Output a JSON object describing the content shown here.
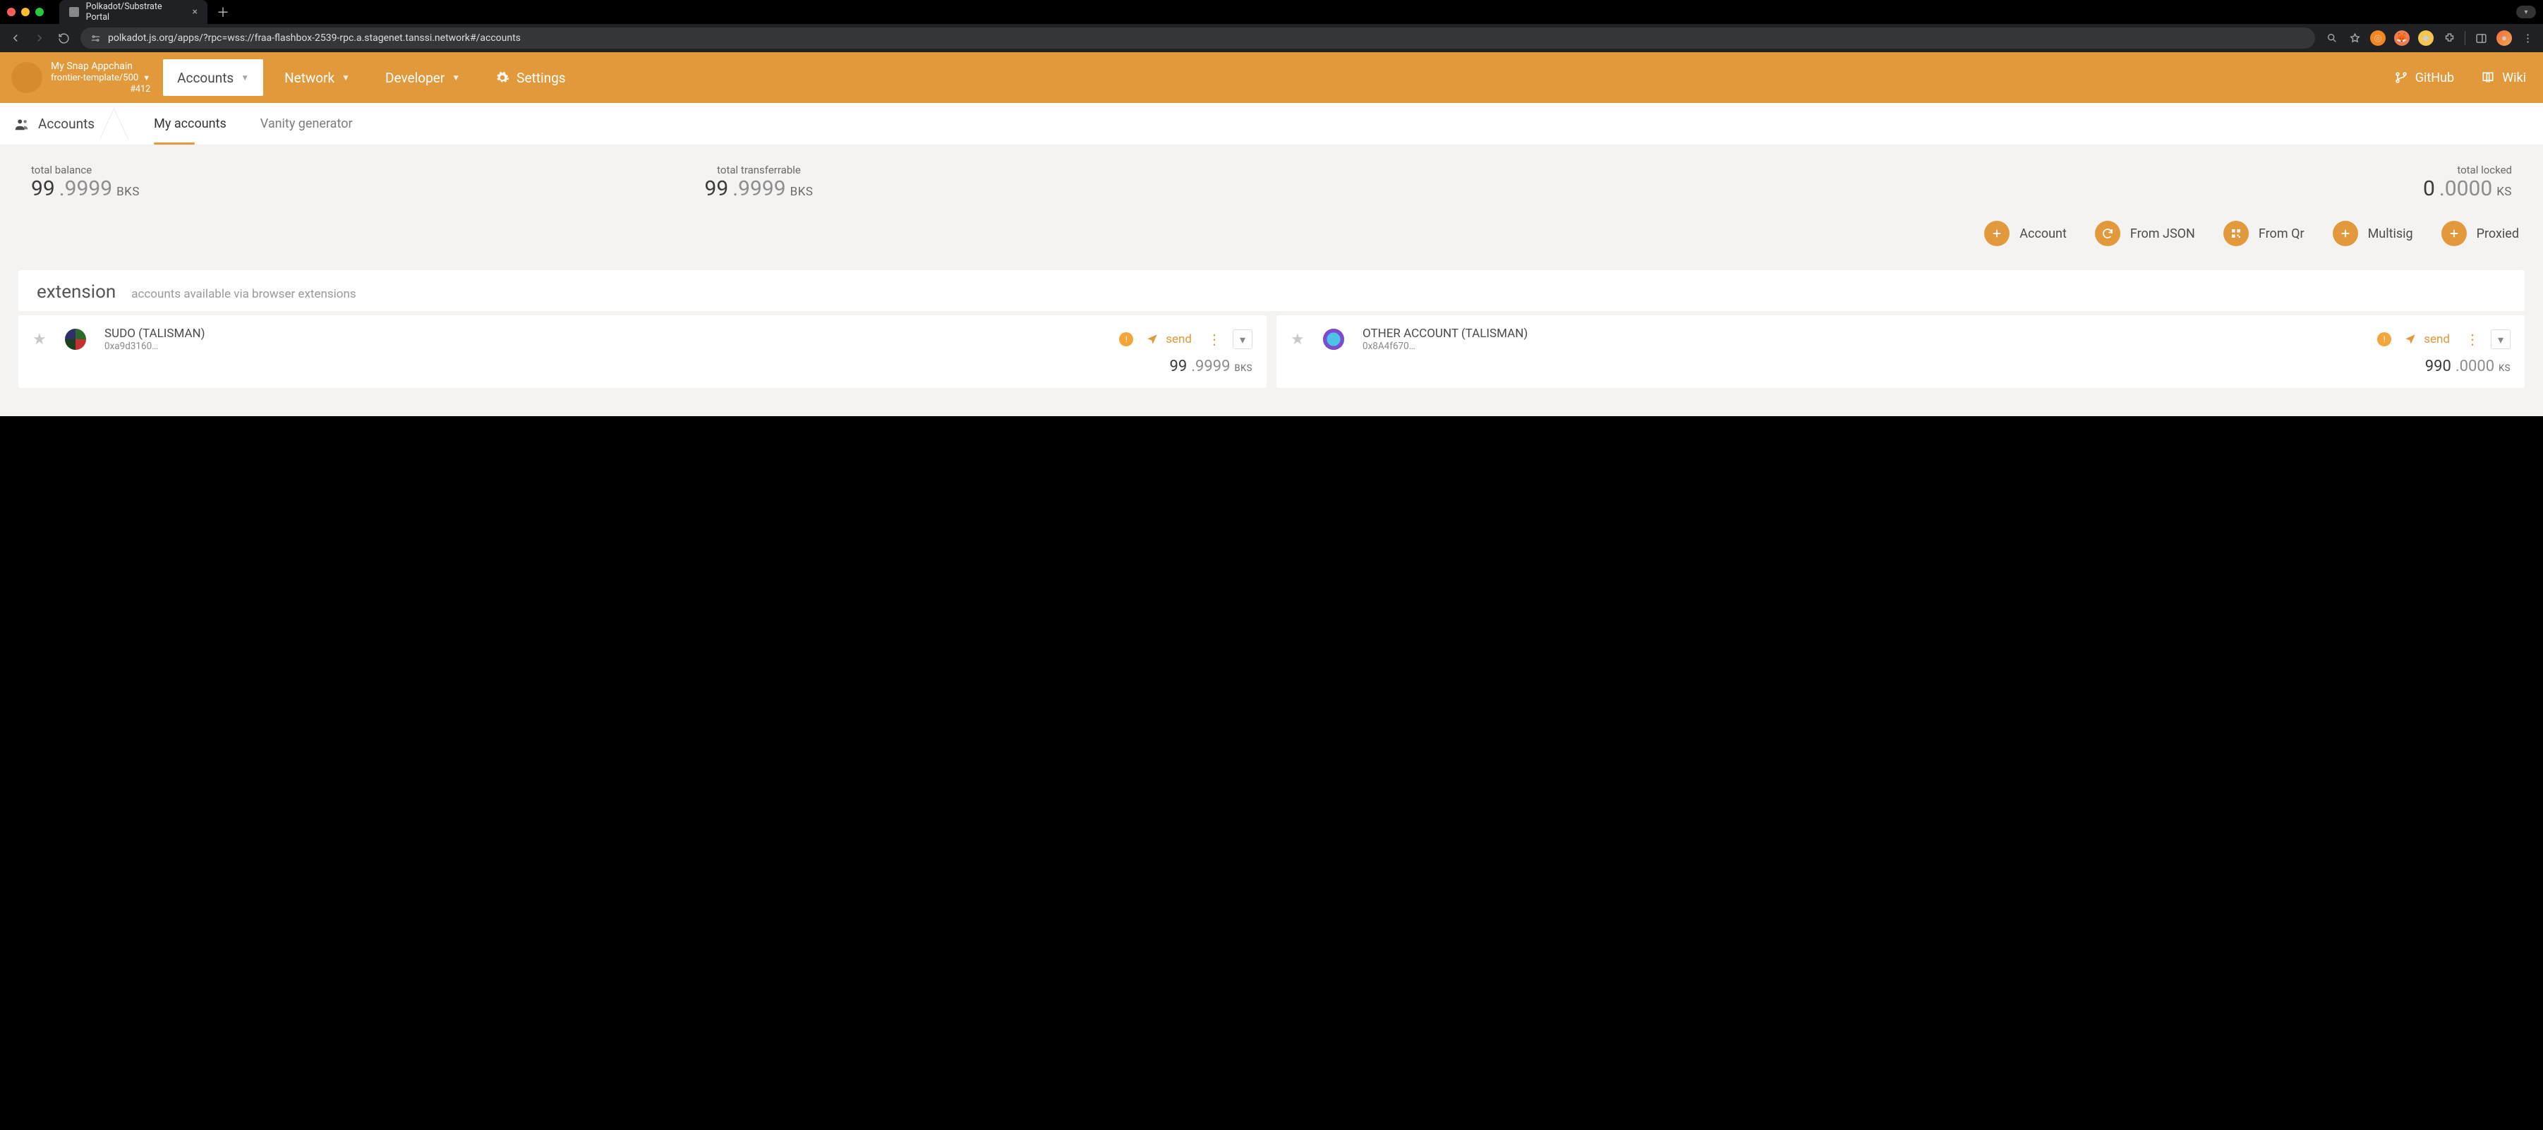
{
  "browser": {
    "tab_title": "Polkadot/Substrate Portal",
    "url": "polkadot.js.org/apps/?rpc=wss://fraa-flashbox-2539-rpc.a.stagenet.tanssi.network#/accounts"
  },
  "chain": {
    "name": "My Snap Appchain",
    "template": "frontier-template/500",
    "block": "#412"
  },
  "top_nav": {
    "accounts": "Accounts",
    "network": "Network",
    "developer": "Developer",
    "settings": "Settings",
    "github": "GitHub",
    "wiki": "Wiki"
  },
  "subnav": {
    "root": "Accounts",
    "tab_my_accounts": "My accounts",
    "tab_vanity": "Vanity generator"
  },
  "summary": {
    "balance_label": "total balance",
    "balance_whole": "99",
    "balance_frac": ".9999",
    "balance_unit": "BKS",
    "transferrable_label": "total transferrable",
    "transferrable_whole": "99",
    "transferrable_frac": ".9999",
    "transferrable_unit": "BKS",
    "locked_label": "total locked",
    "locked_whole": "0",
    "locked_frac": ".0000",
    "locked_unit": "KS"
  },
  "actions": {
    "account": "Account",
    "from_json": "From JSON",
    "from_qr": "From Qr",
    "multisig": "Multisig",
    "proxied": "Proxied"
  },
  "section": {
    "title": "extension",
    "subtitle": "accounts available via browser extensions"
  },
  "accounts": [
    {
      "name": "SUDO (TALISMAN)",
      "address_short": "0xa9d3160…",
      "send_label": "send",
      "balance_whole": "99",
      "balance_frac": ".9999",
      "balance_unit": "BKS"
    },
    {
      "name": "OTHER ACCOUNT (TALISMAN)",
      "address_short": "0x8A4f670…",
      "send_label": "send",
      "balance_whole": "990",
      "balance_frac": ".0000",
      "balance_unit": "KS"
    }
  ]
}
